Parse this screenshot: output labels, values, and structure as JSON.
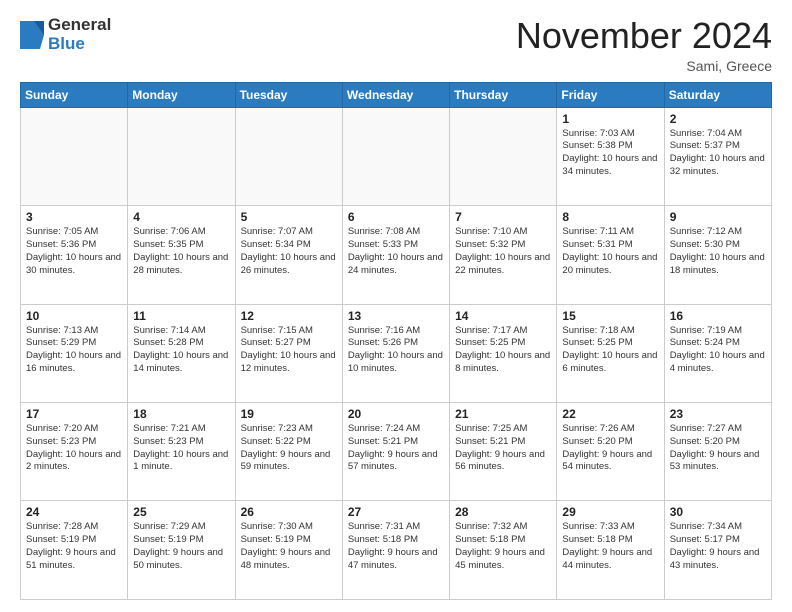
{
  "header": {
    "logo_general": "General",
    "logo_blue": "Blue",
    "month_title": "November 2024",
    "location": "Sami, Greece"
  },
  "weekdays": [
    "Sunday",
    "Monday",
    "Tuesday",
    "Wednesday",
    "Thursday",
    "Friday",
    "Saturday"
  ],
  "weeks": [
    [
      {
        "day": "",
        "info": ""
      },
      {
        "day": "",
        "info": ""
      },
      {
        "day": "",
        "info": ""
      },
      {
        "day": "",
        "info": ""
      },
      {
        "day": "",
        "info": ""
      },
      {
        "day": "1",
        "info": "Sunrise: 7:03 AM\nSunset: 5:38 PM\nDaylight: 10 hours and 34 minutes."
      },
      {
        "day": "2",
        "info": "Sunrise: 7:04 AM\nSunset: 5:37 PM\nDaylight: 10 hours and 32 minutes."
      }
    ],
    [
      {
        "day": "3",
        "info": "Sunrise: 7:05 AM\nSunset: 5:36 PM\nDaylight: 10 hours and 30 minutes."
      },
      {
        "day": "4",
        "info": "Sunrise: 7:06 AM\nSunset: 5:35 PM\nDaylight: 10 hours and 28 minutes."
      },
      {
        "day": "5",
        "info": "Sunrise: 7:07 AM\nSunset: 5:34 PM\nDaylight: 10 hours and 26 minutes."
      },
      {
        "day": "6",
        "info": "Sunrise: 7:08 AM\nSunset: 5:33 PM\nDaylight: 10 hours and 24 minutes."
      },
      {
        "day": "7",
        "info": "Sunrise: 7:10 AM\nSunset: 5:32 PM\nDaylight: 10 hours and 22 minutes."
      },
      {
        "day": "8",
        "info": "Sunrise: 7:11 AM\nSunset: 5:31 PM\nDaylight: 10 hours and 20 minutes."
      },
      {
        "day": "9",
        "info": "Sunrise: 7:12 AM\nSunset: 5:30 PM\nDaylight: 10 hours and 18 minutes."
      }
    ],
    [
      {
        "day": "10",
        "info": "Sunrise: 7:13 AM\nSunset: 5:29 PM\nDaylight: 10 hours and 16 minutes."
      },
      {
        "day": "11",
        "info": "Sunrise: 7:14 AM\nSunset: 5:28 PM\nDaylight: 10 hours and 14 minutes."
      },
      {
        "day": "12",
        "info": "Sunrise: 7:15 AM\nSunset: 5:27 PM\nDaylight: 10 hours and 12 minutes."
      },
      {
        "day": "13",
        "info": "Sunrise: 7:16 AM\nSunset: 5:26 PM\nDaylight: 10 hours and 10 minutes."
      },
      {
        "day": "14",
        "info": "Sunrise: 7:17 AM\nSunset: 5:25 PM\nDaylight: 10 hours and 8 minutes."
      },
      {
        "day": "15",
        "info": "Sunrise: 7:18 AM\nSunset: 5:25 PM\nDaylight: 10 hours and 6 minutes."
      },
      {
        "day": "16",
        "info": "Sunrise: 7:19 AM\nSunset: 5:24 PM\nDaylight: 10 hours and 4 minutes."
      }
    ],
    [
      {
        "day": "17",
        "info": "Sunrise: 7:20 AM\nSunset: 5:23 PM\nDaylight: 10 hours and 2 minutes."
      },
      {
        "day": "18",
        "info": "Sunrise: 7:21 AM\nSunset: 5:23 PM\nDaylight: 10 hours and 1 minute."
      },
      {
        "day": "19",
        "info": "Sunrise: 7:23 AM\nSunset: 5:22 PM\nDaylight: 9 hours and 59 minutes."
      },
      {
        "day": "20",
        "info": "Sunrise: 7:24 AM\nSunset: 5:21 PM\nDaylight: 9 hours and 57 minutes."
      },
      {
        "day": "21",
        "info": "Sunrise: 7:25 AM\nSunset: 5:21 PM\nDaylight: 9 hours and 56 minutes."
      },
      {
        "day": "22",
        "info": "Sunrise: 7:26 AM\nSunset: 5:20 PM\nDaylight: 9 hours and 54 minutes."
      },
      {
        "day": "23",
        "info": "Sunrise: 7:27 AM\nSunset: 5:20 PM\nDaylight: 9 hours and 53 minutes."
      }
    ],
    [
      {
        "day": "24",
        "info": "Sunrise: 7:28 AM\nSunset: 5:19 PM\nDaylight: 9 hours and 51 minutes."
      },
      {
        "day": "25",
        "info": "Sunrise: 7:29 AM\nSunset: 5:19 PM\nDaylight: 9 hours and 50 minutes."
      },
      {
        "day": "26",
        "info": "Sunrise: 7:30 AM\nSunset: 5:19 PM\nDaylight: 9 hours and 48 minutes."
      },
      {
        "day": "27",
        "info": "Sunrise: 7:31 AM\nSunset: 5:18 PM\nDaylight: 9 hours and 47 minutes."
      },
      {
        "day": "28",
        "info": "Sunrise: 7:32 AM\nSunset: 5:18 PM\nDaylight: 9 hours and 45 minutes."
      },
      {
        "day": "29",
        "info": "Sunrise: 7:33 AM\nSunset: 5:18 PM\nDaylight: 9 hours and 44 minutes."
      },
      {
        "day": "30",
        "info": "Sunrise: 7:34 AM\nSunset: 5:17 PM\nDaylight: 9 hours and 43 minutes."
      }
    ]
  ]
}
